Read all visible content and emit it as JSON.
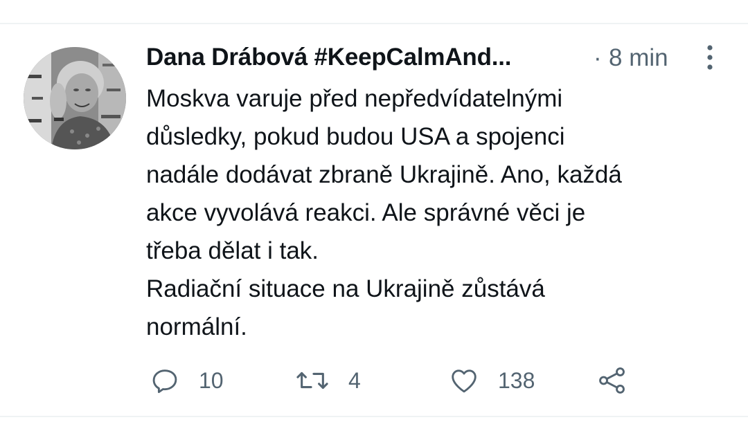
{
  "tweet": {
    "author": {
      "display_name": "Dana Drábová #KeepCalmAnd..."
    },
    "separator": "·",
    "time": "8 min",
    "text_lines": [
      "Moskva varuje před nepředvídatelnými",
      "důsledky, pokud budou USA a spojenci",
      "nadále dodávat zbraně Ukrajině. Ano, každá",
      "akce vyvolává reakci. Ale správné věci je",
      "třeba dělat i tak.",
      "Radiační situace na Ukrajině zůstává",
      "normální."
    ],
    "actions": {
      "reply_icon": "reply-icon",
      "reply_count": "10",
      "retweet_icon": "retweet-icon",
      "retweet_count": "4",
      "like_icon": "heart-icon",
      "like_count": "138",
      "share_icon": "share-icon"
    }
  },
  "colors": {
    "text_primary": "#0f1419",
    "text_secondary": "#536471",
    "divider": "#eff3f4",
    "background": "#ffffff"
  }
}
